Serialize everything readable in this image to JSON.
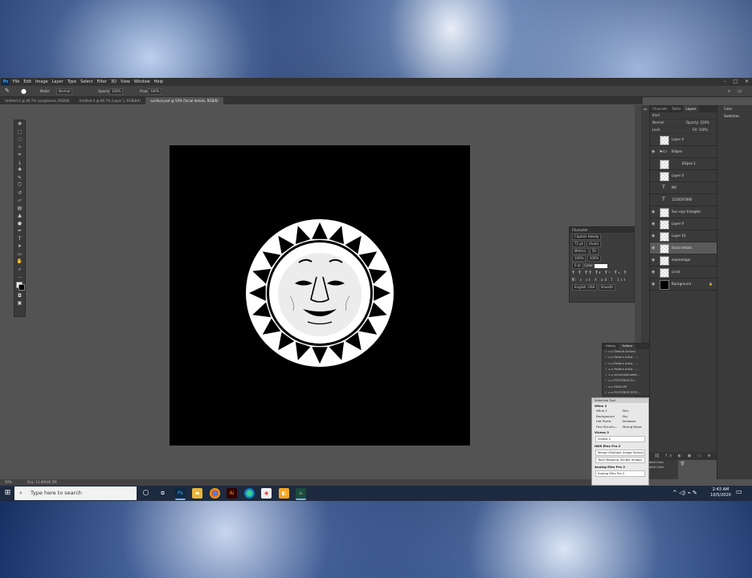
{
  "photoshop": {
    "app_icon": "Ps",
    "menu": [
      "File",
      "Edit",
      "Image",
      "Layer",
      "Type",
      "Select",
      "Filter",
      "3D",
      "View",
      "Window",
      "Help"
    ],
    "options": {
      "mode_label": "Mode:",
      "mode_value": "Normal",
      "opacity_label": "Opacity:",
      "opacity_value": "100%",
      "flow_label": "Flow:",
      "flow_value": "100%"
    },
    "doc_tabs": [
      "Untitled-2 @ 66.7% (sunglasses, RGB/8)",
      "Untitled-3 @ 66.7% (Layer 1, RGB/8#)",
      "sunface.psd @ 50% (facial details, RGB/8)"
    ],
    "status_zoom": "50%",
    "status_doc": "Doc: 11.8M/46.5M",
    "layers_panel": {
      "tabs": [
        "Channels",
        "Paths",
        "Layers"
      ],
      "kind": "Kind",
      "blend": "Normal",
      "opacity_label": "Opacity:",
      "opacity_value": "100%",
      "lock_label": "Lock:",
      "fill_label": "Fill:",
      "fill_value": "100%",
      "layers": [
        {
          "name": "Layer 4",
          "visible": false,
          "type": "image"
        },
        {
          "name": "Ellipse",
          "visible": true,
          "type": "group"
        },
        {
          "name": "Ellipse 1",
          "visible": false,
          "type": "shape"
        },
        {
          "name": "Layer 4",
          "visible": false,
          "type": "image"
        },
        {
          "name": "NO",
          "visible": false,
          "type": "text"
        },
        {
          "name": "1234567890",
          "visible": false,
          "type": "text"
        },
        {
          "name": "Sun rays triangles",
          "visible": true,
          "type": "image"
        },
        {
          "name": "Layer 9",
          "visible": true,
          "type": "image"
        },
        {
          "name": "Layer 10",
          "visible": true,
          "type": "image"
        },
        {
          "name": "facial details",
          "visible": true,
          "type": "image"
        },
        {
          "name": "moonshape",
          "visible": true,
          "type": "image"
        },
        {
          "name": "circle",
          "visible": true,
          "type": "image"
        },
        {
          "name": "Background",
          "visible": true,
          "type": "background"
        }
      ]
    },
    "side_strip": [
      "Color",
      "Swatches"
    ],
    "side_strip_bottom": [
      "ated Color",
      "ated Color"
    ],
    "character_panel": {
      "title": "Character",
      "font": "Captain Howdy",
      "size": "72 pt",
      "leading": "(Auto)",
      "kerning": "Metrics",
      "tracking": "50",
      "vscale": "100%",
      "hscale": "100%",
      "baseline": "0 pt",
      "color_label": "Color:",
      "language": "English: USA",
      "antialias": "Smooth"
    },
    "actions_panel": {
      "tabs": [
        "History",
        "Actions"
      ],
      "items": [
        "Default Actions",
        "Pattern Artist - ...",
        "Pattern Artist - ...",
        "Pattern Artist - ...",
        "actionsAlphabet...",
        "POSTERIZE Ex...",
        "READ ME",
        "POSTERIZE EFFE..."
      ]
    },
    "selective_tool": {
      "title": "Selective Tool",
      "dfine_header": "Dfine 2",
      "dfine_items": [
        "Dfine 2",
        "Skin",
        "Background",
        "Sky",
        "Hot Pixels",
        "Shadows",
        "Fine Structu...",
        "Strong Noise"
      ],
      "viveza_header": "Viveza 2",
      "viveza_button": "Viveza 2",
      "hdr_header": "HDR Efex Pro 2",
      "hdr_buttons": [
        "Merge (Multiple Image Series)",
        "Tone Mapping (Single Image)"
      ],
      "analog_header": "Analog Efex Pro 2",
      "analog_button": "Analog Efex Pro 2"
    }
  },
  "taskbar": {
    "search_placeholder": "Type here to search",
    "time": "2:43 AM",
    "date": "10/5/2020"
  }
}
